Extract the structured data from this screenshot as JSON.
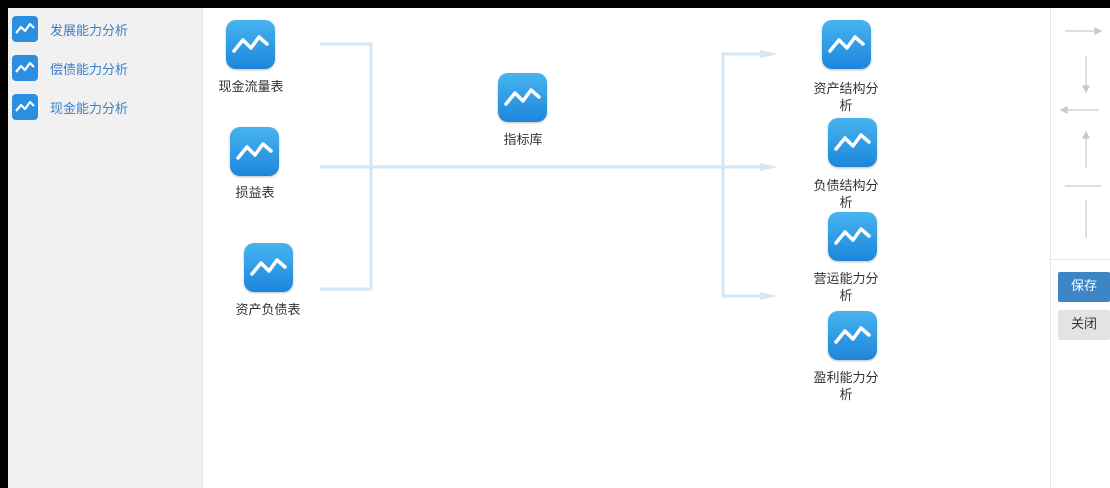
{
  "sidebar": {
    "items": [
      {
        "label": "发展能力分析",
        "icon": "trend-chart-icon"
      },
      {
        "label": "偿债能力分析",
        "icon": "trend-chart-icon"
      },
      {
        "label": "现金能力分析",
        "icon": "trend-chart-icon"
      }
    ]
  },
  "canvas": {
    "sources": [
      {
        "label": "现金流量表",
        "icon": "trend-chart-icon"
      },
      {
        "label": "损益表",
        "icon": "trend-chart-icon"
      },
      {
        "label": "资产负债表",
        "icon": "trend-chart-icon"
      }
    ],
    "hub": {
      "label": "指标库",
      "icon": "trend-chart-icon"
    },
    "outputs": [
      {
        "label": "资产结构分析",
        "icon": "trend-chart-icon"
      },
      {
        "label": "负债结构分析",
        "icon": "trend-chart-icon"
      },
      {
        "label": "营运能力分析",
        "icon": "trend-chart-icon"
      },
      {
        "label": "盈利能力分析",
        "icon": "trend-chart-icon"
      }
    ]
  },
  "toolbar": {
    "save_label": "保存",
    "close_label": "关闭",
    "tools": [
      "arrow-right-icon",
      "arrow-down-icon",
      "arrow-left-icon",
      "arrow-up-icon",
      "horizontal-line-icon",
      "vertical-line-icon"
    ]
  },
  "colors": {
    "accent": "#3d86c6",
    "link_text": "#3b7fc4",
    "connector": "#d5e7f4",
    "sidebar_bg": "#f1f1f1"
  }
}
